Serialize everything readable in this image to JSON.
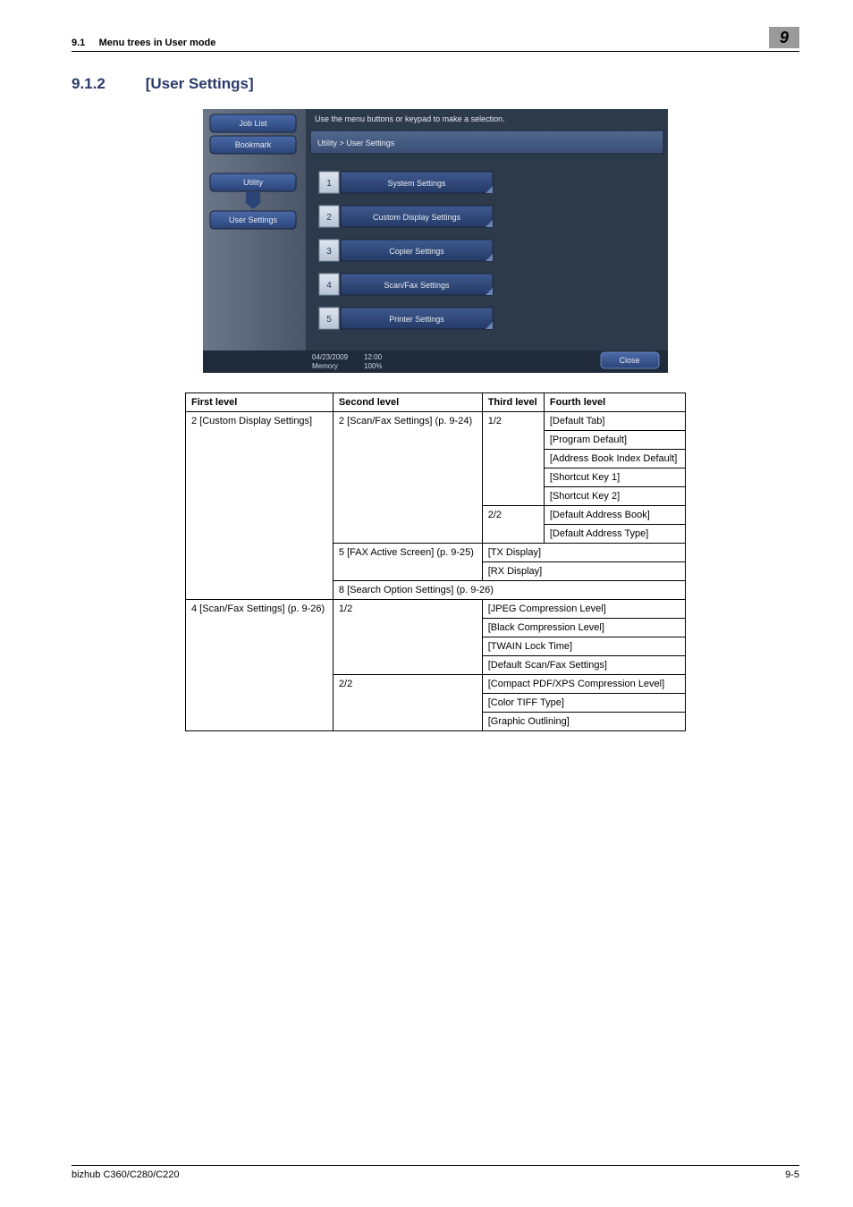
{
  "header": {
    "section_number": "9.1",
    "section_title": "Menu trees in User mode",
    "chapter_badge": "9"
  },
  "section_heading": {
    "number": "9.1.2",
    "title": "[User Settings]"
  },
  "screenshot": {
    "top_hint": "Use the menu buttons or keypad to make a selection.",
    "breadcrumb": "Utility > User Settings",
    "left_tabs": {
      "job_list": "Job List",
      "bookmark": "Bookmark",
      "utility": "Utility",
      "user_settings": "User Settings"
    },
    "menu_items": [
      {
        "num": "1",
        "label": "System Settings"
      },
      {
        "num": "2",
        "label": "Custom Display Settings"
      },
      {
        "num": "3",
        "label": "Copier Settings"
      },
      {
        "num": "4",
        "label": "Scan/Fax Settings"
      },
      {
        "num": "5",
        "label": "Printer Settings"
      }
    ],
    "footer_date": "04/23/2009",
    "footer_time": "12:00",
    "footer_mem_label": "Memory",
    "footer_mem_val": "100%",
    "close_btn": "Close"
  },
  "table": {
    "headers": {
      "first": "First level",
      "second": "Second level",
      "third": "Third level",
      "fourth": "Fourth level"
    },
    "r1_first": "2 [Custom Display Settings]",
    "r1_second": "2 [Scan/Fax Settings] (p. 9-24)",
    "r1_third_page": "1/2",
    "r1_third_a": "[Default Tab]",
    "r1_third_b": "[Program Default]",
    "r1_third_c": "[Address Book Index Default]",
    "r1_third_d": "[Shortcut Key 1]",
    "r1_third_e": "[Shortcut Key 2]",
    "r1_third_page2": "2/2",
    "r1_third_f": "[Default Address Book]",
    "r1_third_g": "[Default Address Type]",
    "r2_second": "5 [FAX Active Screen] (p. 9-25)",
    "r2_third_a": "[TX Display]",
    "r2_third_b": "[RX Display]",
    "r3_second": "8 [Search Option Settings] (p. 9-26)",
    "r4_first": "4 [Scan/Fax Settings] (p. 9-26)",
    "r4_second_page": "1/2",
    "r4_a": "[JPEG Compression Level]",
    "r4_b": "[Black Compression Level]",
    "r4_c": "[TWAIN Lock Time]",
    "r4_d": "[Default Scan/Fax Settings]",
    "r4_second_page2": "2/2",
    "r4_e": "[Compact PDF/XPS Compression Level]",
    "r4_f": "[Color TIFF Type]",
    "r4_g": "[Graphic Outlining]"
  },
  "footer": {
    "left": "bizhub C360/C280/C220",
    "right": "9-5"
  }
}
